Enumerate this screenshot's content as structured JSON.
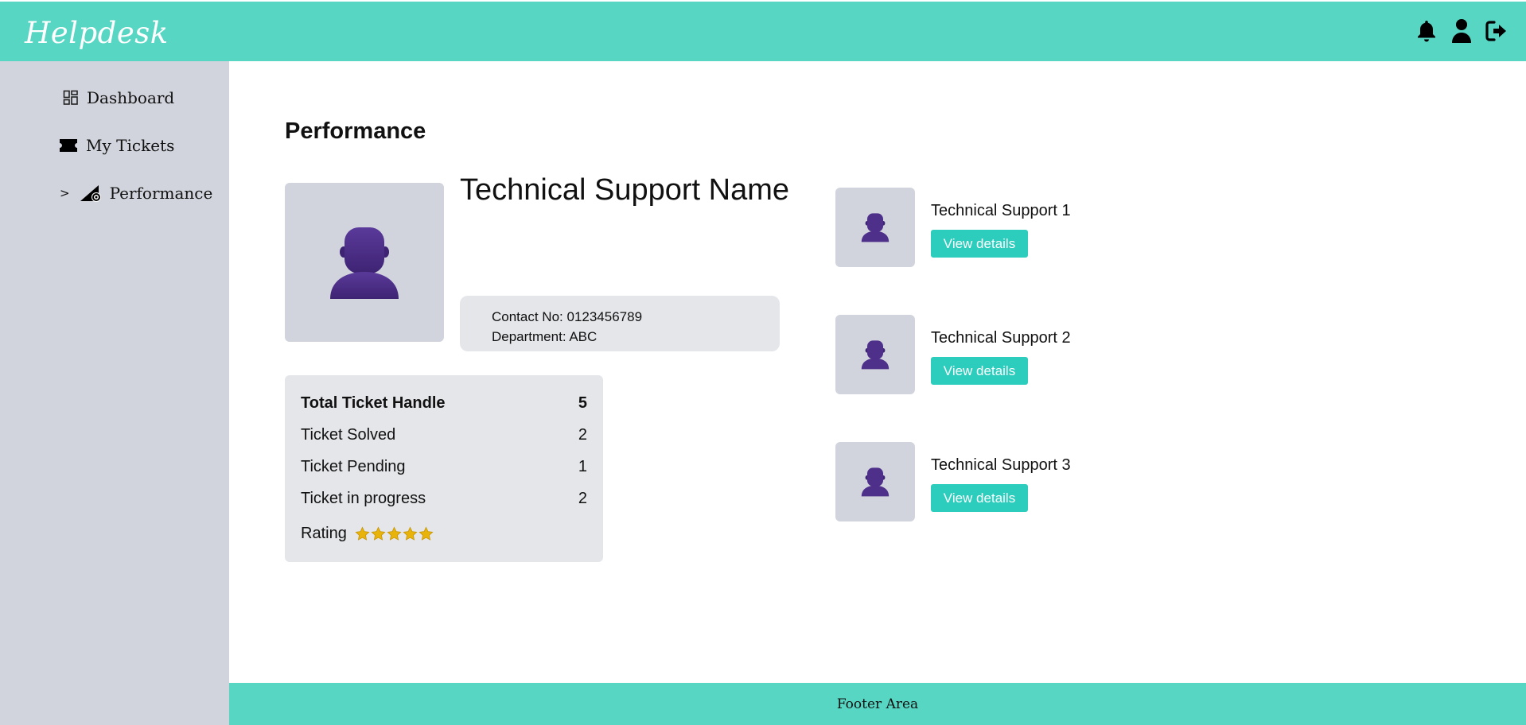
{
  "header": {
    "brand": "Helpdesk",
    "icons": [
      "bell-icon",
      "user-icon",
      "logout-icon"
    ],
    "color": "#56d6c3"
  },
  "sidebar": {
    "items": [
      {
        "label": "Dashboard",
        "icon": "dashboard-grid-icon"
      },
      {
        "label": "My Tickets",
        "icon": "ticket-icon"
      },
      {
        "label": "Performance",
        "icon": "performance-gauge-icon",
        "marker": ">",
        "active": true
      }
    ],
    "color": "#d1d4dc"
  },
  "main": {
    "title": "Performance",
    "profile": {
      "name": "Technical Support Name",
      "contact": "Contact No: 0123456789",
      "department": "Department: ABC"
    },
    "stats": [
      {
        "label": "Total Ticket Handle",
        "value": "5"
      },
      {
        "label": "Ticket Solved",
        "value": "2"
      },
      {
        "label": "Ticket Pending",
        "value": "1"
      },
      {
        "label": "Ticket in progress",
        "value": "2"
      }
    ],
    "rating": {
      "label": "Rating",
      "stars": 5,
      "max": 5,
      "color": "#e8b30b"
    },
    "support_list": [
      {
        "name": "Technical Support 1",
        "button": "View details"
      },
      {
        "name": "Technical Support 2",
        "button": "View details"
      },
      {
        "name": "Technical Support 3",
        "button": "View details"
      }
    ],
    "button_color": "#2ccdbc"
  },
  "footer": {
    "text": "Footer Area"
  }
}
